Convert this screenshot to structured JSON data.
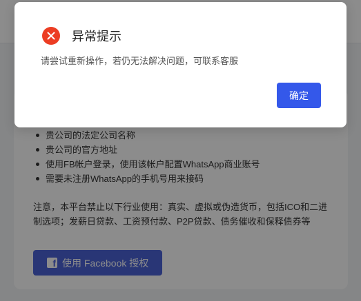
{
  "background": {
    "requirements": [
      "贵公司的法定公司名称",
      "贵公司的官方地址",
      "使用FB帐户登录，使用该帐户配置WhatsApp商业账号",
      "需要未注册WhatsApp的手机号用来接码"
    ],
    "notice": "注意，本平台禁止以下行业使用：真实、虚拟或伪造货币，包括ICO和二进制选项；发薪日贷款、工资预付款、P2P贷款、债务催收和保释债券等",
    "facebook_button_label": "使用 Facebook 授权",
    "facebook_icon_glyph": "f"
  },
  "dialog": {
    "title": "异常提示",
    "message": "请尝试重新操作，若仍无法解决问题，可联系客服",
    "confirm_label": "确定",
    "icon": "close-circle-icon"
  },
  "colors": {
    "error_red": "#ec3d23",
    "primary_blue": "#3458ea",
    "facebook_blue": "#4b63d8"
  }
}
